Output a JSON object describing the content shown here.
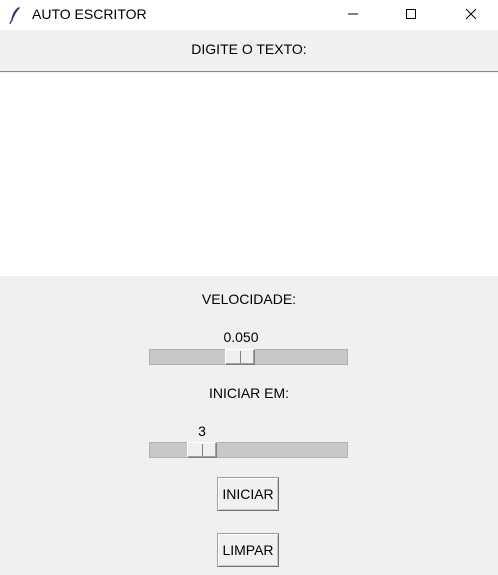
{
  "window": {
    "title": "AUTO ESCRITOR",
    "icon": "feather-icon",
    "controls": [
      "minimize-icon",
      "maximize-icon",
      "close-icon"
    ]
  },
  "prompt": {
    "label": "DIGITE O TEXTO:"
  },
  "text_input": {
    "value": ""
  },
  "speed": {
    "label": "VELOCIDADE:",
    "value": "0.050"
  },
  "start_delay": {
    "label": "INICIAR EM:",
    "value": "3"
  },
  "buttons": {
    "start_label": "INICIAR",
    "clear_label": "LIMPAR"
  },
  "colors": {
    "background": "#f0f0f0",
    "trough": "#c8c8c8",
    "text_area": "#ffffff"
  }
}
